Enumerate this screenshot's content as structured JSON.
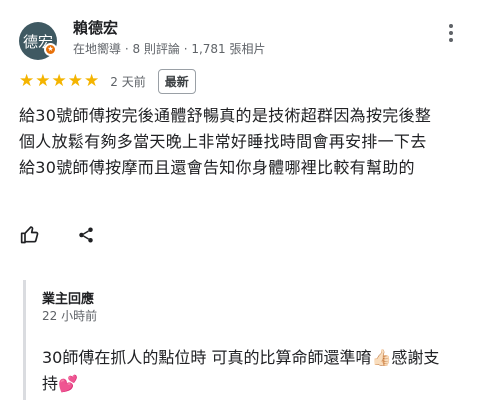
{
  "reviewer": {
    "avatar_text": "德宏",
    "name": "賴德宏",
    "meta": "在地嚮導 · 8 則評論 · 1,781 張相片"
  },
  "rating": {
    "stars": 5,
    "time_ago": "2 天前",
    "badge": "最新"
  },
  "review": {
    "text": "給30號師傅按完後通體舒暢真的是技術超群因為按完後整個人放鬆有夠多當天晚上非常好睡找時間會再安排一下去給30號師傅按摩而且還會告知你身體哪裡比較有幫助的"
  },
  "owner_reply": {
    "title": "業主回應",
    "time": "22 小時前",
    "text_part1": "30師傅在抓人的點位時 可真的比算命師還準唷",
    "emoji1": "👍🏻",
    "text_part2": "感謝支持",
    "emoji2": "💕"
  },
  "icons": {
    "like": "thumbs-up-icon",
    "share": "share-icon",
    "more": "more-vert-icon",
    "local_guide": "local-guide-badge-icon"
  },
  "colors": {
    "star": "#f4b400",
    "avatar_bg": "#3f5962",
    "badge_orange": "#e8710a",
    "secondary_text": "#5f6368"
  }
}
